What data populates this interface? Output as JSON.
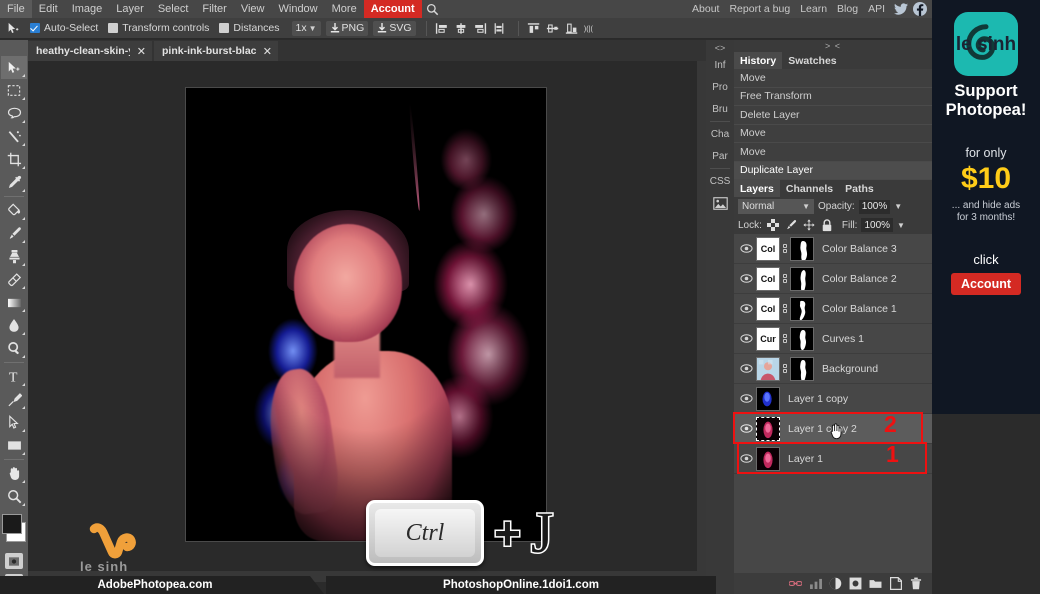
{
  "menu": {
    "items": [
      "File",
      "Edit",
      "Image",
      "Layer",
      "Select",
      "Filter",
      "View",
      "Window",
      "More"
    ],
    "account_label": "Account",
    "search_icon": "search-icon",
    "right_items": [
      "About",
      "Report a bug",
      "Learn",
      "Blog",
      "API"
    ],
    "social": [
      "twitter-icon",
      "facebook-icon"
    ],
    "accent_color": "#d42a23"
  },
  "options_bar": {
    "tool_icon": "move-tool-icon",
    "auto_select_label": "Auto-Select",
    "auto_select_checked": true,
    "transform_controls_label": "Transform controls",
    "transform_controls_checked": false,
    "distances_label": "Distances",
    "distances_checked": false,
    "zoom_value": "1x",
    "png_label": "PNG",
    "svg_label": "SVG",
    "align_icons": [
      "align-left-icon",
      "align-center-h-icon",
      "align-right-icon",
      "distribute-h-icon",
      "align-top-icon",
      "align-middle-v-icon",
      "align-bottom-icon",
      "distribute-v-icon"
    ]
  },
  "tabs": [
    {
      "name": "heathy-clean-skin-yo",
      "active": true,
      "close": "✕"
    },
    {
      "name": "pink-ink-burst-black",
      "active": false,
      "close": "✕"
    }
  ],
  "toolbar": {
    "tools": [
      "move-tool-icon",
      "rectangular-marquee-icon",
      "lasso-icon",
      "magic-wand-icon",
      "crop-icon",
      "eyedropper-icon",
      "paint-bucket-icon",
      "brush-icon",
      "clone-stamp-icon",
      "eraser-icon",
      "gradient-icon",
      "blur-icon",
      "dodge-icon",
      "type-tool-icon",
      "pen-tool-icon",
      "path-select-icon",
      "shape-icon",
      "hand-tool-icon",
      "zoom-tool-icon"
    ],
    "foreground_color": "#111111",
    "background_color": "#ffffff",
    "quick-mask-icon": "quick-mask-icon",
    "screen-mode-icon": "screen-mode-icon"
  },
  "mini_panels": {
    "collapse": "<>",
    "items": [
      "Inf",
      "Pro",
      "Bru",
      "Cha",
      "Par",
      "CSS"
    ],
    "image_icon": "image-icon"
  },
  "history_panel": {
    "collapse": "> <",
    "tabs": [
      {
        "label": "History",
        "selected": true
      },
      {
        "label": "Swatches",
        "selected": false
      }
    ],
    "entries": [
      {
        "label": "Move",
        "current": false
      },
      {
        "label": "Free Transform",
        "current": false
      },
      {
        "label": "Delete Layer",
        "current": false
      },
      {
        "label": "Move",
        "current": false
      },
      {
        "label": "Move",
        "current": false
      },
      {
        "label": "Duplicate Layer",
        "current": true
      }
    ]
  },
  "layers_panel": {
    "tabs": [
      {
        "label": "Layers",
        "selected": true
      },
      {
        "label": "Channels",
        "selected": false
      },
      {
        "label": "Paths",
        "selected": false
      }
    ],
    "blend_mode": "Normal",
    "opacity_label": "Opacity:",
    "opacity_value": "100%",
    "lock_label": "Lock:",
    "lock_icons": [
      "lock-transparency-icon",
      "lock-paint-icon",
      "lock-move-icon",
      "lock-all-icon"
    ],
    "fill_label": "Fill:",
    "fill_value": "100%",
    "layers": [
      {
        "name": "Color Balance 3",
        "type": "adjustment",
        "thumb_text": "Col",
        "has_mask": true,
        "visible": true,
        "selected": false
      },
      {
        "name": "Color Balance 2",
        "type": "adjustment",
        "thumb_text": "Col",
        "has_mask": true,
        "visible": true,
        "selected": false
      },
      {
        "name": "Color Balance 1",
        "type": "adjustment",
        "thumb_text": "Col",
        "has_mask": true,
        "visible": true,
        "selected": false
      },
      {
        "name": "Curves 1",
        "type": "adjustment",
        "thumb_text": "Cur",
        "has_mask": true,
        "visible": true,
        "selected": false
      },
      {
        "name": "Background",
        "type": "image",
        "thumb_text": "",
        "has_mask": true,
        "visible": true,
        "selected": false
      },
      {
        "name": "Layer 1 copy",
        "type": "image",
        "thumb_text": "",
        "has_mask": false,
        "visible": true,
        "selected": false
      },
      {
        "name": "Layer 1 copy 2",
        "type": "image",
        "thumb_text": "",
        "has_mask": false,
        "visible": true,
        "selected": true
      },
      {
        "name": "Layer 1",
        "type": "image",
        "thumb_text": "",
        "has_mask": false,
        "visible": true,
        "selected": false
      }
    ],
    "bottom_icons": [
      "link-layers-icon",
      "layer-style-icon",
      "adjustment-layer-icon",
      "layer-mask-icon",
      "new-group-icon",
      "new-layer-icon",
      "delete-layer-icon"
    ]
  },
  "annotations": [
    {
      "number": "2",
      "target_layer": "Layer 1 copy 2",
      "color": "#ee1111"
    },
    {
      "number": "1",
      "target_layer": "Layer 1",
      "color": "#ee1111"
    }
  ],
  "keyboard_hint": {
    "key": "Ctrl",
    "plus": "+",
    "second_key": "J"
  },
  "ad": {
    "logo_icon": "photopea-logo-icon",
    "ghost_text": "le sinh",
    "title_line1": "Support",
    "title_line2": "Photopea!",
    "for_only": "for only",
    "price": "$10",
    "sub_line1": "... and hide ads",
    "sub_line2": "for 3 months!",
    "click_label": "click",
    "button_label": "Account",
    "price_color": "#ffcc18",
    "button_color": "#d42a23"
  },
  "watermarks": {
    "left": "AdobePhotopea.com",
    "middle": "PhotoshopOnline.1doi1.com",
    "logo_caption": "le sinh",
    "logo_color": "#f0a03a"
  }
}
